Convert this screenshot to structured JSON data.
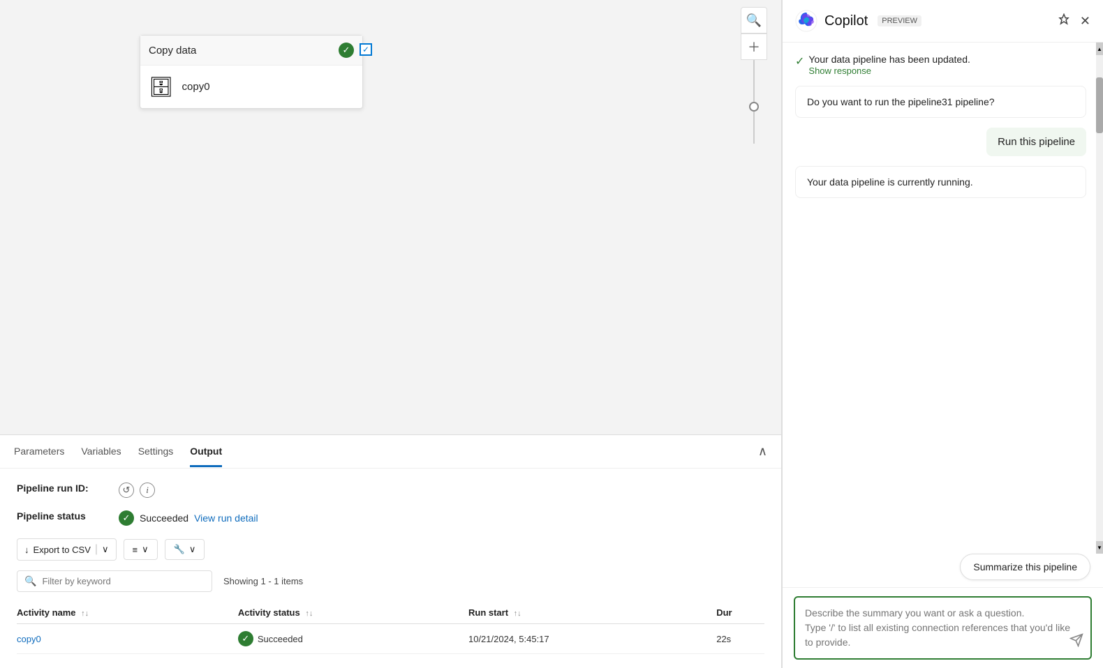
{
  "canvas": {
    "activity_card": {
      "title": "Copy data",
      "activity_name": "copy0",
      "db_icon": "🗄"
    }
  },
  "tabs": {
    "items": [
      "Parameters",
      "Variables",
      "Settings",
      "Output"
    ],
    "active": "Output"
  },
  "output": {
    "pipeline_run_id_label": "Pipeline run ID:",
    "pipeline_status_label": "Pipeline status",
    "status_text": "Succeeded",
    "view_run_detail": "View run detail",
    "export_csv": "Export to CSV",
    "showing": "Showing 1 - 1 items",
    "filter_placeholder": "Filter by keyword",
    "table": {
      "columns": [
        "Activity name",
        "Activity status",
        "Run start",
        "Dur"
      ],
      "rows": [
        {
          "activity_name": "copy0",
          "activity_status": "Succeeded",
          "run_start": "10/21/2024, 5:45:17",
          "duration": "22s"
        }
      ]
    }
  },
  "copilot": {
    "title": "Copilot",
    "preview": "PREVIEW",
    "messages": [
      {
        "type": "system",
        "text": "Your data pipeline has been updated.",
        "show_response": "Show response"
      },
      {
        "type": "bot",
        "text": "Do you want to run the pipeline31 pipeline?"
      },
      {
        "type": "user",
        "text": "Run this pipeline"
      },
      {
        "type": "bot",
        "text": "Your data pipeline is currently running."
      }
    ],
    "suggest_btn": "Summarize this pipeline",
    "input_placeholder_line1": "Describe the summary you want or ask a",
    "input_placeholder_line2": "question.",
    "input_placeholder_line3": "Type '/' to list all existing connection",
    "input_placeholder_line4": "references that you'd like to provide."
  }
}
